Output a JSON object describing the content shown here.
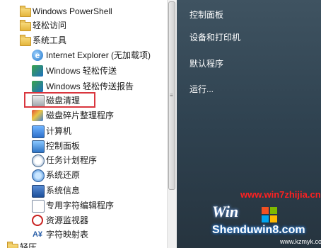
{
  "left_items": [
    {
      "label": "Windows PowerShell",
      "icon": "folder-icon",
      "indent": "top"
    },
    {
      "label": "轻松访问",
      "icon": "folder-icon",
      "indent": "top"
    },
    {
      "label": "系统工具",
      "icon": "folder-icon",
      "indent": "top"
    },
    {
      "label": "Internet Explorer (无加载项)",
      "icon": "internet-explorer-icon",
      "indent": "sub"
    },
    {
      "label": "Windows 轻松传送",
      "icon": "easy-transfer-icon",
      "indent": "sub"
    },
    {
      "label": "Windows 轻松传送报告",
      "icon": "easy-transfer-report-icon",
      "indent": "sub"
    },
    {
      "label": "磁盘清理",
      "icon": "disk-cleanup-icon",
      "indent": "sub"
    },
    {
      "label": "磁盘碎片整理程序",
      "icon": "defragmenter-icon",
      "indent": "sub"
    },
    {
      "label": "计算机",
      "icon": "computer-icon",
      "indent": "sub"
    },
    {
      "label": "控制面板",
      "icon": "control-panel-icon",
      "indent": "sub"
    },
    {
      "label": "任务计划程序",
      "icon": "task-scheduler-icon",
      "indent": "sub"
    },
    {
      "label": "系统还原",
      "icon": "system-restore-icon",
      "indent": "sub"
    },
    {
      "label": "系统信息",
      "icon": "system-info-icon",
      "indent": "sub"
    },
    {
      "label": "专用字符编辑程序",
      "icon": "char-editor-icon",
      "indent": "sub"
    },
    {
      "label": "资源监视器",
      "icon": "resource-monitor-icon",
      "indent": "sub"
    },
    {
      "label": "字符映射表",
      "icon": "character-map-icon",
      "indent": "sub"
    },
    {
      "label": "轻压",
      "icon": "folder-icon",
      "indent": "top"
    }
  ],
  "right_items": [
    {
      "label": "控制面板"
    },
    {
      "label": "设备和打印机"
    },
    {
      "label": "默认程序"
    },
    {
      "label": "运行..."
    }
  ],
  "watermark": {
    "url": "www.win7zhijia.cn",
    "brand": "Shenduwin8.com",
    "site": "www.kzmyk.com",
    "logo": "Win"
  },
  "colors": {
    "highlight": "#d9363e",
    "right_panel": "#2f4250",
    "watermark_red": "#ff2020"
  }
}
